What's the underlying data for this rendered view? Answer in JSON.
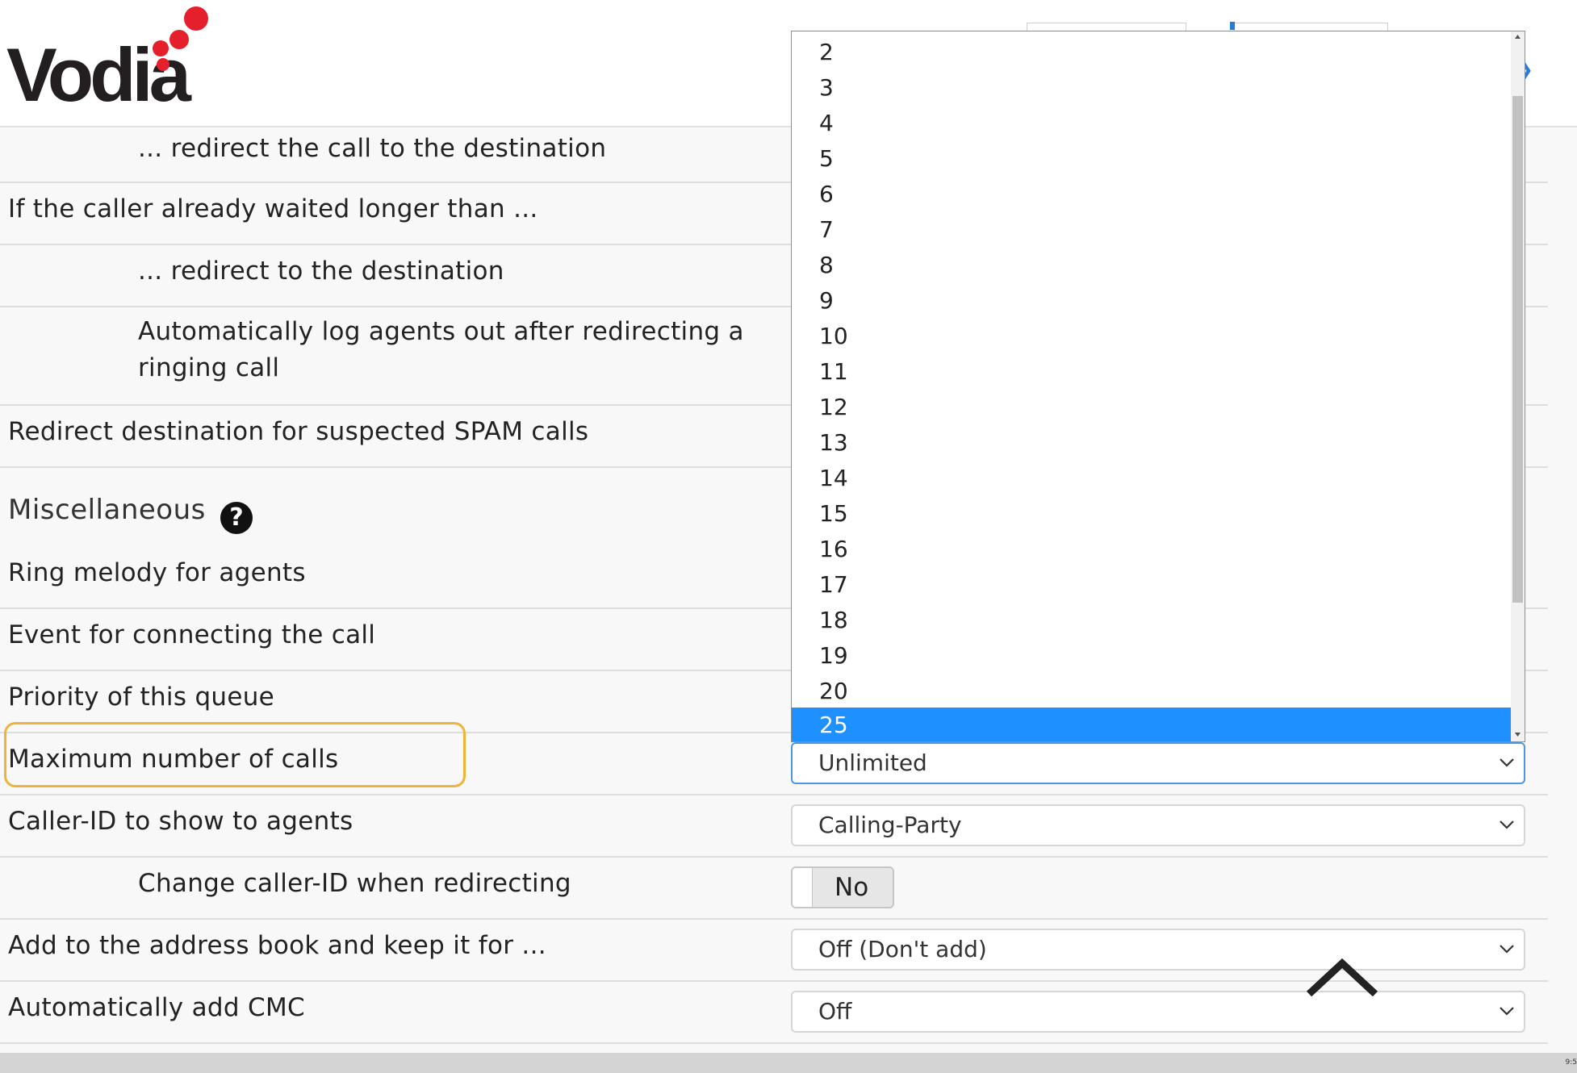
{
  "brand": {
    "logo_text": "Vodia",
    "dot_color": "#e3202b"
  },
  "rows": {
    "redirect_call": "... redirect the call to the destination",
    "waited_longer": "If the caller already waited longer than ...",
    "redirect_to": "... redirect to the destination",
    "auto_logout": "Automatically log agents out after redirecting a ringing call",
    "spam_redirect": "Redirect destination for suspected SPAM calls",
    "ring_melody": "Ring melody for agents",
    "event_connecting": "Event for connecting the call",
    "priority": "Priority of this queue",
    "max_calls": "Maximum number of calls",
    "caller_id_agents": "Caller-ID to show to agents",
    "change_caller_id": "Change caller-ID when redirecting",
    "address_book": "Add to the address book and keep it for ...",
    "auto_cmc": "Automatically add CMC"
  },
  "section": {
    "misc_title": "Miscellaneous",
    "help_icon": "?"
  },
  "fields": {
    "max_calls_value": "Unlimited",
    "caller_id_value": "Calling-Party",
    "change_caller_id_toggle": "No",
    "address_book_value": "Off (Don't add)",
    "auto_cmc_value": "Off"
  },
  "dropdown": {
    "options": [
      "2",
      "3",
      "4",
      "5",
      "6",
      "7",
      "8",
      "9",
      "10",
      "11",
      "12",
      "13",
      "14",
      "15",
      "16",
      "17",
      "18",
      "19",
      "20",
      "25"
    ],
    "highlighted": "25"
  },
  "colors": {
    "accent": "#1e90ff",
    "highlight_border": "#f0b23d",
    "focus_border": "#4d96e6"
  },
  "status": {
    "clock": "9:5"
  }
}
